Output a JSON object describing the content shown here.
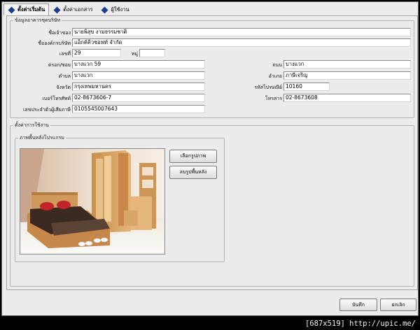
{
  "tabs": [
    {
      "label": "ตั้งค่าเริ่มต้น"
    },
    {
      "label": "ตั้งค่าเอกสาร"
    },
    {
      "label": "ผู้ใช้งาน"
    }
  ],
  "company_info": {
    "legend": "ข้อมูลอาคารชุดบริษัท",
    "owner_name": {
      "label": "ชื่อเจ้าของ",
      "value": "นายพิสุข งามธรรมชาติ"
    },
    "company_name": {
      "label": "ชื่อองค์กรบริษัท",
      "value": "แอ็กค์คิวซอฟท์ จำกัด"
    },
    "house_no": {
      "label": "เลขที่",
      "value": "29"
    },
    "moo": {
      "label": "หมู่",
      "value": ""
    },
    "soi": {
      "label": "ตรอก/ซอย",
      "value": "บางแวก 59"
    },
    "road": {
      "label": "ถนน",
      "value": "บางแวก"
    },
    "subdistrict": {
      "label": "ตำบล",
      "value": "บางแวก"
    },
    "district": {
      "label": "อำเภอ",
      "value": "ภาษีเจริญ"
    },
    "province": {
      "label": "จังหวัด",
      "value": "กรุงเทพมหานคร"
    },
    "postcode": {
      "label": "รหัสไปรษณีย์",
      "value": "10160"
    },
    "phone": {
      "label": "เบอร์โทรศัพท์",
      "value": "02-8673606-7"
    },
    "fax": {
      "label": "โทรสาร",
      "value": "02-8673608"
    },
    "tax_id": {
      "label": "เลขประจำตัวผู้เสียภาษี",
      "value": "0105545007643"
    }
  },
  "usage": {
    "legend": "ตั้งค่าการใช้งาน",
    "background_legend": "ภาพพื้นหลังโปรแกรม",
    "choose_image_button": "เลือกรูปภาพ",
    "delete_background_button": "ลบรูปพื้นหลัง"
  },
  "footer": {
    "save_button": "บันทึก",
    "cancel_button": "ยกเลิก"
  },
  "watermark": "[687x519] http://upic.me/",
  "colors": {
    "tab_icon": "#1e3c8c",
    "window_bg": "#ececec"
  }
}
